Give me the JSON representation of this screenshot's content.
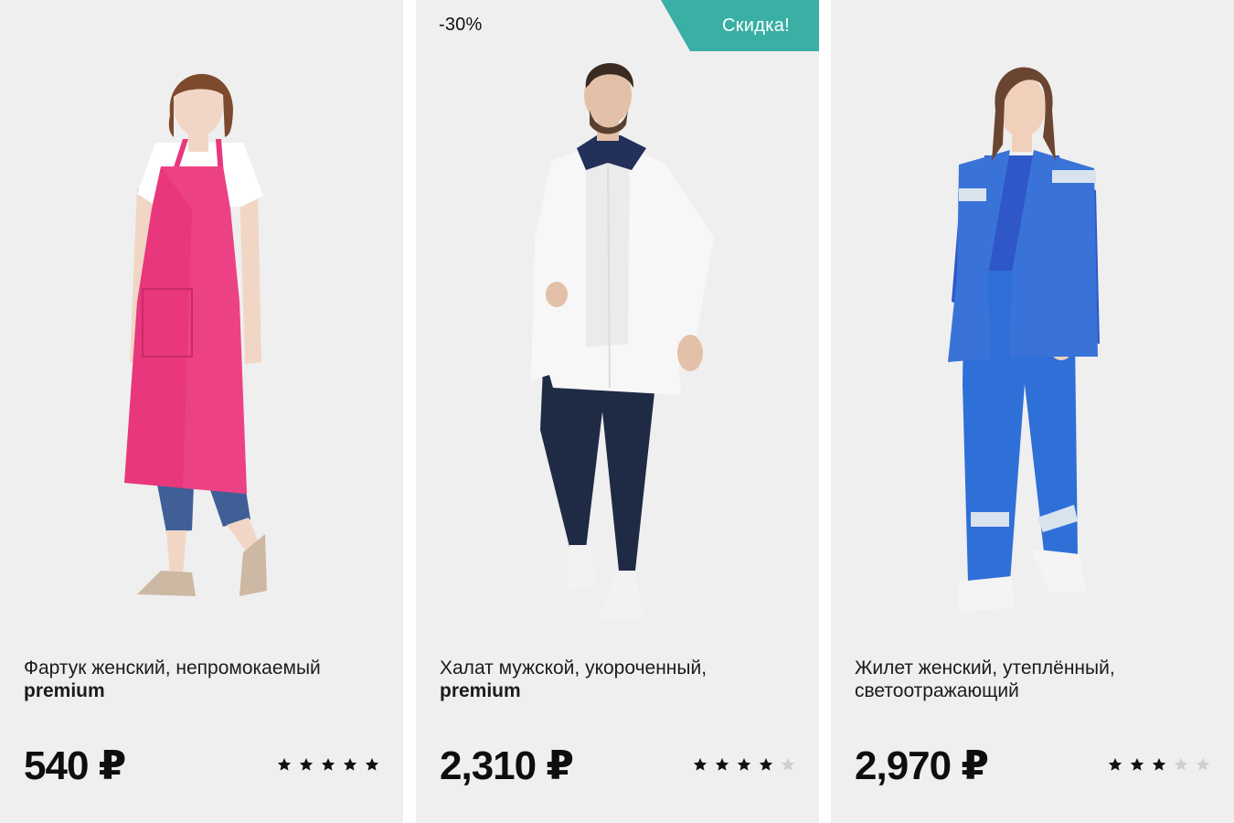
{
  "products": [
    {
      "title_line1": "Фартук женский, непромокаемый",
      "title_line2": "premium",
      "title_line2_bold": true,
      "price": "540 ₽",
      "rating": 5,
      "rating_max": 5,
      "discount_label": "",
      "sale_badge": "",
      "garment_color": "#e8377d"
    },
    {
      "title_line1": "Халат мужской, укороченный,",
      "title_line2": "premium",
      "title_line2_bold": true,
      "price": "2,310 ₽",
      "rating": 4,
      "rating_max": 5,
      "discount_label": "-30%",
      "sale_badge": "Скидка!",
      "garment_color": "#f7f7f7"
    },
    {
      "title_line1": "Жилет женский, утеплённый,",
      "title_line2": "светоотражающий",
      "title_line2_bold": false,
      "price": "2,970 ₽",
      "rating": 3,
      "rating_max": 5,
      "discount_label": "",
      "sale_badge": "",
      "garment_color": "#3a6fd6"
    }
  ],
  "colors": {
    "card_background": "#efefef",
    "sale_badge": "#3aafa4",
    "star_filled": "#111111",
    "star_empty": "#cfcfcf"
  },
  "icons": {
    "star": "star-icon"
  }
}
